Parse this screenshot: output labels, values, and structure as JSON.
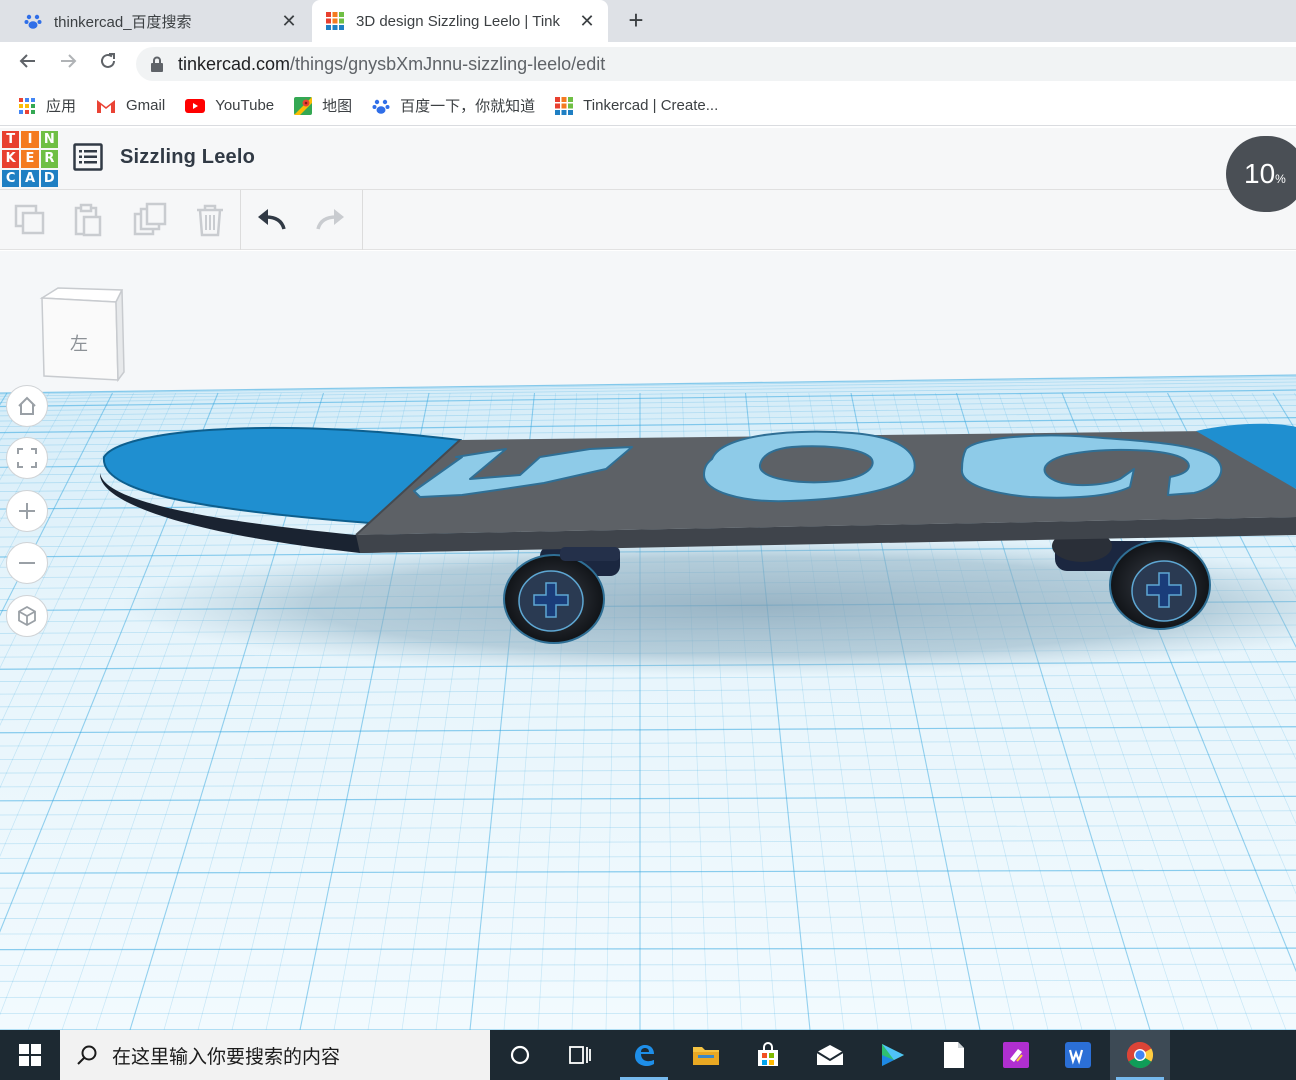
{
  "browser": {
    "tabs": [
      {
        "title": "thinkercad_百度搜索",
        "icon": "baidu-paw-icon",
        "active": false
      },
      {
        "title": "3D design Sizzling Leelo | Tink",
        "icon": "tinkercad-icon",
        "active": true
      }
    ],
    "new_tab_label": "+",
    "close_label": "✕",
    "url_domain": "tinkercad.com",
    "url_path": "/things/gnysbXmJnnu-sizzling-leelo/edit",
    "bookmarks": [
      {
        "label": "应用",
        "icon": "apps-grid-icon"
      },
      {
        "label": "Gmail",
        "icon": "gmail-icon"
      },
      {
        "label": "YouTube",
        "icon": "youtube-icon"
      },
      {
        "label": "地图",
        "icon": "maps-icon"
      },
      {
        "label": "百度一下，你就知道",
        "icon": "baidu-paw-icon"
      },
      {
        "label": "Tinkercad | Create...",
        "icon": "tinkercad-icon"
      }
    ]
  },
  "app": {
    "logo_letters": [
      "T",
      "I",
      "N",
      "K",
      "E",
      "R",
      "C",
      "A",
      "D"
    ],
    "logo_colors": [
      "#e8402f",
      "#f47b20",
      "#6fbf44",
      "#e8402f",
      "#f47b20",
      "#6fbf44",
      "#1f7fc3",
      "#1f7fc3",
      "#1f7fc3"
    ],
    "design_title": "Sizzling Leelo",
    "progress_value": "10",
    "progress_unit": "%",
    "view_cube_label": "左",
    "edit_tools": [
      "copy",
      "paste",
      "duplicate",
      "delete",
      "undo",
      "redo"
    ],
    "view_controls": [
      "home-view",
      "fit-all",
      "zoom-in",
      "zoom-out",
      "orthographic"
    ]
  },
  "taskbar": {
    "search_placeholder": "在这里输入你要搜索的内容",
    "apps": [
      "cortana",
      "task-view",
      "edge",
      "file-explorer",
      "store",
      "mail",
      "video",
      "notepad",
      "visual-studio",
      "wps",
      "chrome"
    ]
  },
  "colors": {
    "grid_blue": "#35a8e0",
    "deck_gray": "#5d6166",
    "deck_blue": "#1f8fd0",
    "text_blue": "#8ecbe8",
    "taskbar": "#1d2932"
  }
}
